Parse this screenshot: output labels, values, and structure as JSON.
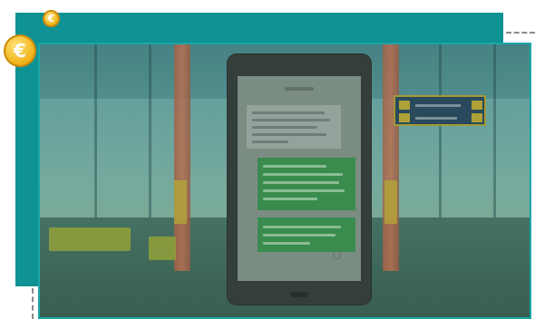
{
  "coins": {
    "small_symbol": "€",
    "large_symbol": "€"
  },
  "colors": {
    "teal_panel": "#0f9294",
    "frame_border": "#1aa7a8",
    "coin_gold": "#f2b51c",
    "outgoing_bubble": "#3f9a52"
  },
  "icons": [
    "euro-coin-icon",
    "euro-coin-icon"
  ]
}
